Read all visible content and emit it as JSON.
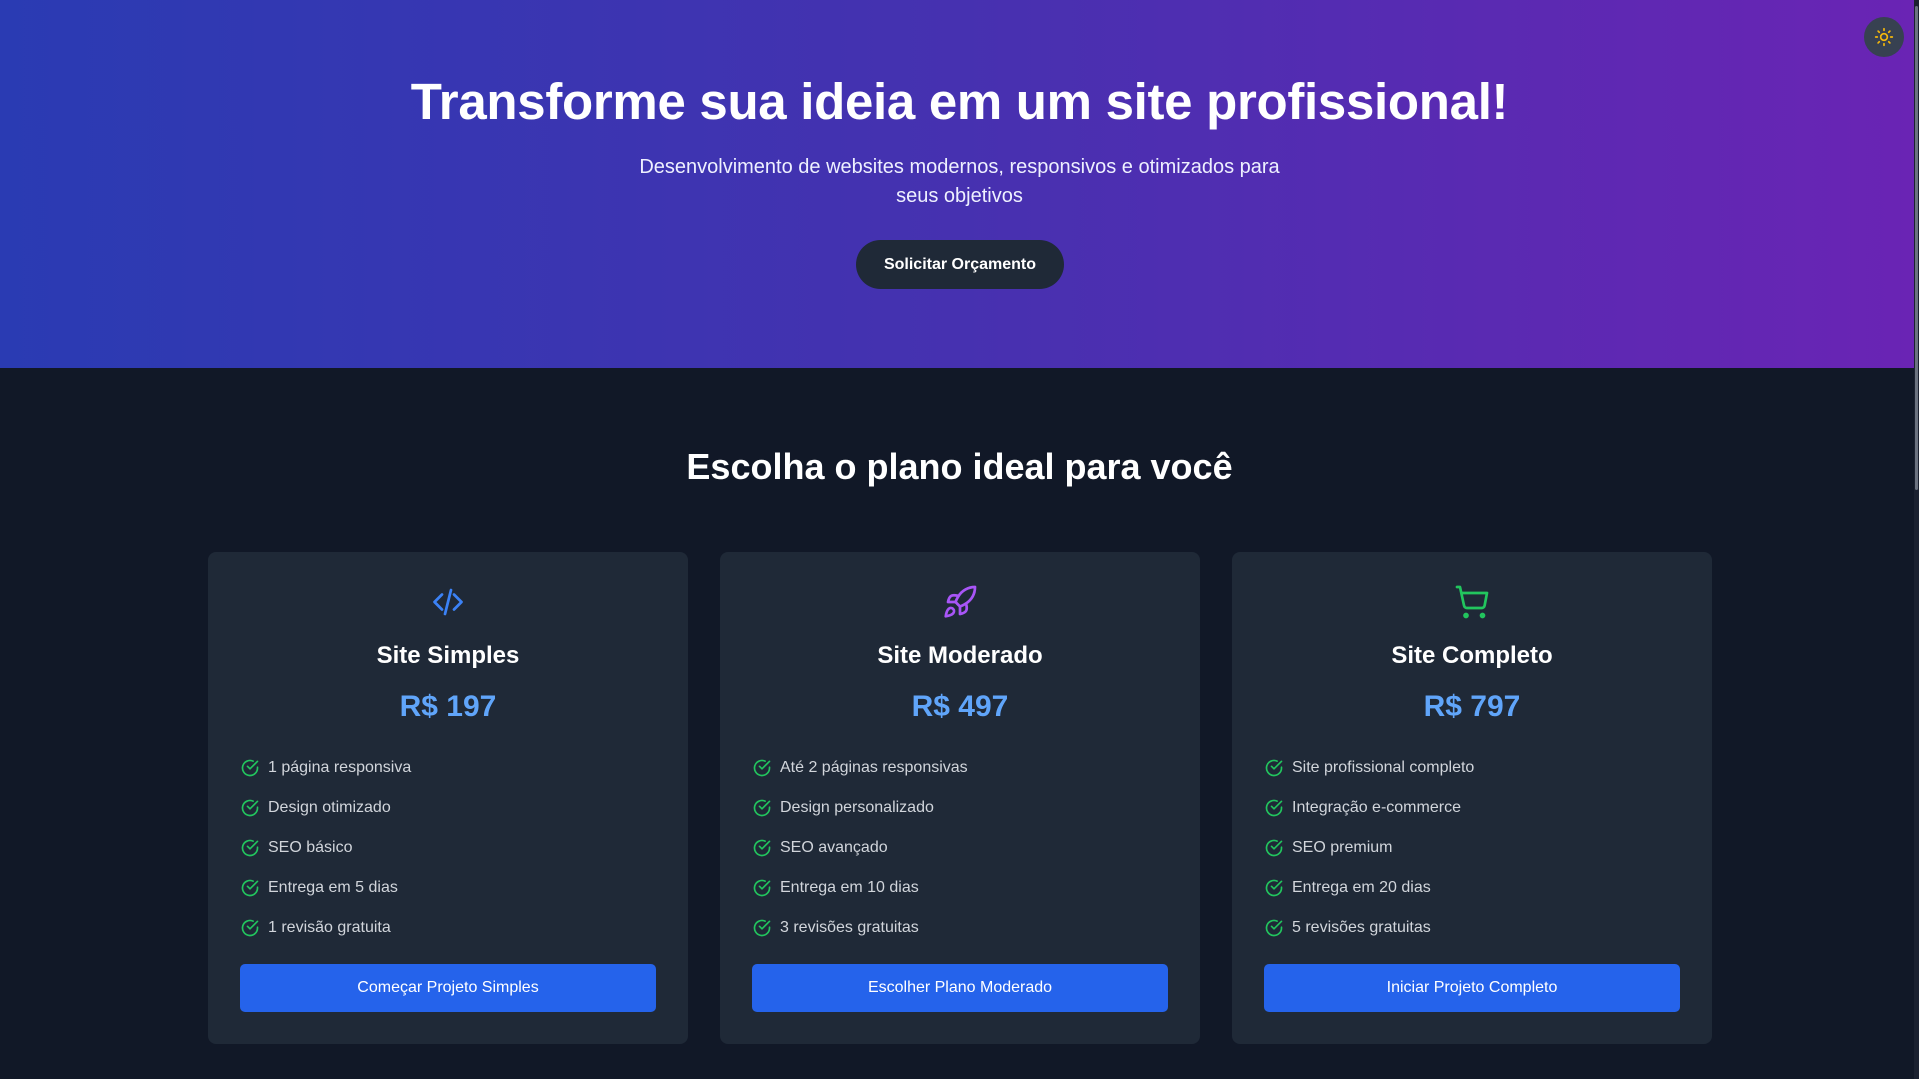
{
  "hero": {
    "title": "Transforme sua ideia em um site profissional!",
    "subtitle": "Desenvolvimento de websites modernos, responsivos e otimizados para seus objetivos",
    "cta_label": "Solicitar Orçamento"
  },
  "theme_toggle": {
    "icon": "sun-icon"
  },
  "pricing": {
    "title": "Escolha o plano ideal para você",
    "plans": [
      {
        "icon": "code-icon",
        "icon_color": "#3b82f6",
        "name": "Site Simples",
        "price": "R$ 197",
        "features": [
          "1 página responsiva",
          "Design otimizado",
          "SEO básico",
          "Entrega em 5 dias",
          "1 revisão gratuita"
        ],
        "button": "Começar Projeto Simples"
      },
      {
        "icon": "rocket-icon",
        "icon_color": "#a855f7",
        "name": "Site Moderado",
        "price": "R$ 497",
        "features": [
          "Até 2 páginas responsivas",
          "Design personalizado",
          "SEO avançado",
          "Entrega em 10 dias",
          "3 revisões gratuitas"
        ],
        "button": "Escolher Plano Moderado"
      },
      {
        "icon": "shopping-cart-icon",
        "icon_color": "#22c55e",
        "name": "Site Completo",
        "price": "R$ 797",
        "features": [
          "Site profissional completo",
          "Integração e-commerce",
          "SEO premium",
          "Entrega em 20 dias",
          "5 revisões gratuitas"
        ],
        "button": "Iniciar Projeto Completo"
      }
    ]
  },
  "colors": {
    "hero_gradient_start": "#2a3bb3",
    "hero_gradient_end": "#6a24b4",
    "page_bg": "#111827",
    "card_bg": "#1f2937",
    "price": "#60a5fa",
    "check": "#22c55e",
    "button": "#2563eb"
  }
}
